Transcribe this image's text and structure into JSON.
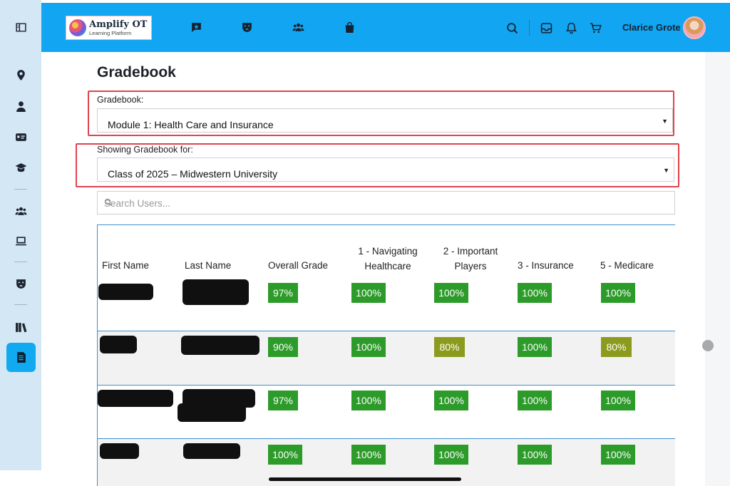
{
  "app": {
    "logo_title": "Amplify OT",
    "logo_subtitle": "Learning Platform"
  },
  "header": {
    "user_name": "Clarice Grote"
  },
  "page": {
    "title": "Gradebook"
  },
  "filters": {
    "gradebook_label": "Gradebook:",
    "gradebook_value": "Module 1: Health Care and Insurance",
    "showing_label": "Showing Gradebook for:",
    "showing_value": "Class of 2025 – Midwestern University",
    "search_placeholder": "Search Users..."
  },
  "table": {
    "headers": {
      "first_name": "First Name",
      "last_name": "Last Name",
      "overall": "Overall Grade",
      "col1_line1": "1 - Navigating",
      "col1_line2": "Healthcare",
      "col2_line1": "2 - Important",
      "col2_line2": "Players",
      "col3": "3 - Insurance",
      "col5": "5 - Medicare"
    },
    "rows": [
      {
        "overall": "97%",
        "c1": "100%",
        "c2": "100%",
        "c3": "100%",
        "c5": "100%"
      },
      {
        "overall": "90%",
        "c1": "100%",
        "c2": "80%",
        "c3": "100%",
        "c5": "80%"
      },
      {
        "overall": "97%",
        "c1": "100%",
        "c2": "100%",
        "c3": "100%",
        "c5": "100%"
      },
      {
        "overall": "100%",
        "c1": "100%",
        "c2": "100%",
        "c3": "100%",
        "c5": "100%"
      }
    ]
  },
  "colors": {
    "topbar": "#12a6f2",
    "sidebar": "#d4e7f5",
    "grade_full": "#2d9b2a",
    "grade_partial": "#8c9b1e",
    "highlight_box": "#e0424f",
    "table_border": "#3e8fd0"
  },
  "icons": {
    "sidebar": [
      "sidebar-toggle-icon",
      "location-pin-icon",
      "user-icon",
      "id-card-icon",
      "graduation-cap-icon",
      "users-icon",
      "laptop-icon",
      "mask-icon",
      "books-icon",
      "gradebook-icon"
    ],
    "topbar": [
      "chat-icon",
      "mask-icon",
      "users-icon",
      "shopping-bag-icon",
      "search-icon",
      "inbox-icon",
      "bell-icon",
      "cart-icon"
    ]
  }
}
